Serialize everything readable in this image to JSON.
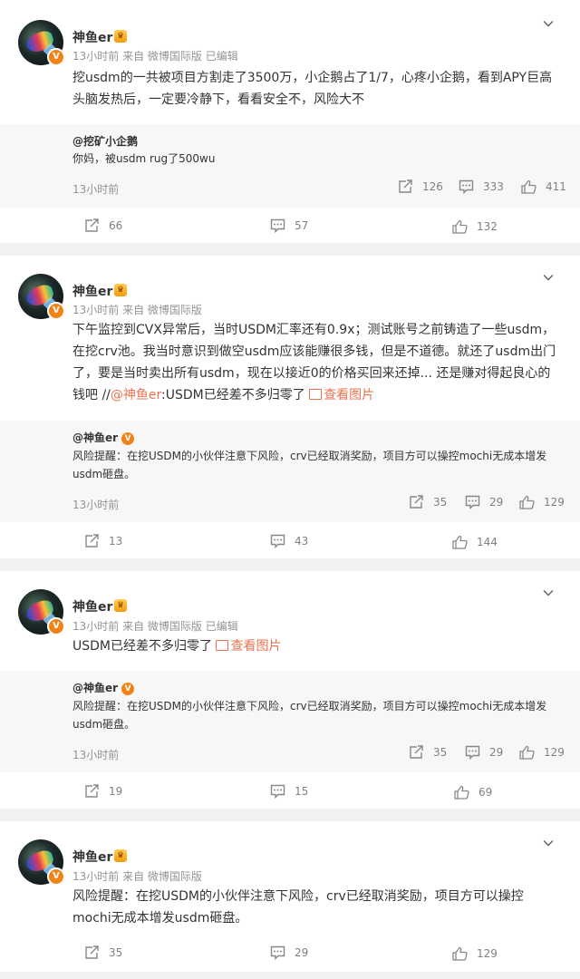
{
  "posts": [
    {
      "author": "神鱼er",
      "meta": "13小时前 来自 微博国际版 已编辑",
      "text": "挖usdm的一共被项目方割走了3500万，小企鹅占了1/7，心疼小企鹅，看到APY巨高头脑发热后，一定要冷静下，看看安全不，风险大不",
      "repost": {
        "author": "@挖矿小企鹅",
        "text": "你妈，被usdm rug了500wu",
        "time": "13小时前",
        "reposts": "126",
        "comments": "333",
        "likes": "411"
      },
      "reposts": "66",
      "comments": "57",
      "likes": "132"
    },
    {
      "author": "神鱼er",
      "meta": "13小时前 来自 微博国际版",
      "text_l1": "下午监控到CVX异常后，当时USDM汇率还有0.9x；测试账号之前铸造了一些usdm，",
      "text_l2": "在挖crv池。我当时意识到做空usdm应该能赚很多钱，但是不道德。就还了usdm出门",
      "text_l3": "了，要是当时卖出所有usdm，现在以接近0的价格买回来还掉... 还是赚对得起良心的",
      "text_l4_pre": "钱吧 //",
      "mention": "@神鱼er",
      "text_l4_post": ":USDM已经差不多归零了",
      "view_pic": "查看图片",
      "repost": {
        "author": "@神鱼er",
        "text": "风险提醒：在挖USDM的小伙伴注意下风险，crv已经取消奖励，项目方可以操控mochi无成本增发usdm砸盘。",
        "time": "13小时前",
        "reposts": "35",
        "comments": "29",
        "likes": "129"
      },
      "reposts": "13",
      "comments": "43",
      "likes": "144"
    },
    {
      "author": "神鱼er",
      "meta": "13小时前 来自 微博国际版 已编辑",
      "text": "USDM已经差不多归零了",
      "view_pic": "查看图片",
      "repost": {
        "author": "@神鱼er",
        "text": "风险提醒：在挖USDM的小伙伴注意下风险，crv已经取消奖励，项目方可以操控mochi无成本增发usdm砸盘。",
        "time": "13小时前",
        "reposts": "35",
        "comments": "29",
        "likes": "129"
      },
      "reposts": "19",
      "comments": "15",
      "likes": "69"
    },
    {
      "author": "神鱼er",
      "meta": "13小时前 来自 微博国际版",
      "text": "风险提醒：在挖USDM的小伙伴注意下风险，crv已经取消奖励，项目方可以操控mochi无成本增发usdm砸盘。",
      "reposts": "35",
      "comments": "29",
      "likes": "129"
    }
  ],
  "icons": {
    "verified": "v-badge",
    "medal": "vip-medal",
    "repost": "repost-icon",
    "comment": "comment-icon",
    "like": "thumbs-up-icon",
    "chevron": "chevron-down-icon",
    "picture": "picture-icon"
  },
  "colors": {
    "accent": "#eb7350",
    "verified": "#f18216",
    "muted": "#939393",
    "background": "#f2f2f2"
  }
}
